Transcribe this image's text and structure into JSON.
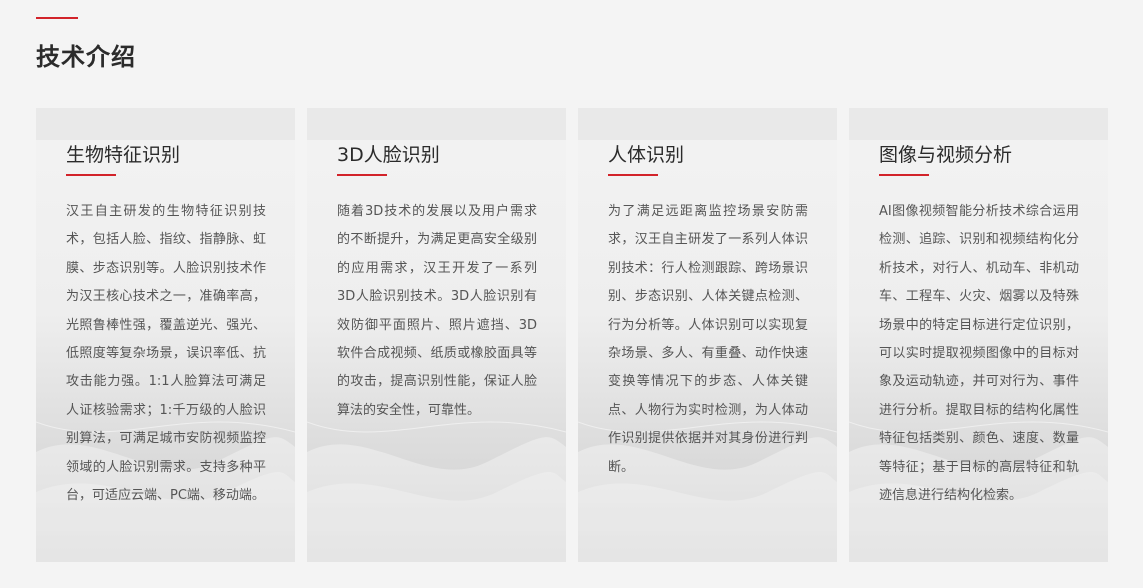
{
  "section": {
    "title": "技术介绍"
  },
  "cards": [
    {
      "title": "生物特征识别",
      "text": "汉王自主研发的生物特征识别技术，包括人脸、指纹、指静脉、虹膜、步态识别等。人脸识别技术作为汉王核心技术之一，准确率高，光照鲁棒性强，覆盖逆光、强光、低照度等复杂场景，误识率低、抗攻击能力强。1:1人脸算法可满足人证核验需求；1:千万级的人脸识别算法，可满足城市安防视频监控领域的人脸识别需求。支持多种平台，可适应云端、PC端、移动端。"
    },
    {
      "title": "3D人脸识别",
      "text": "随着3D技术的发展以及用户需求的不断提升，为满足更高安全级别的应用需求，汉王开发了一系列3D人脸识别技术。3D人脸识别有效防御平面照片、照片遮挡、3D软件合成视频、纸质或橡胶面具等的攻击，提高识别性能，保证人脸算法的安全性，可靠性。"
    },
    {
      "title": "人体识别",
      "text": "为了满足远距离监控场景安防需求，汉王自主研发了一系列人体识别技术：行人检测跟踪、跨场景识别、步态识别、人体关键点检测、行为分析等。人体识别可以实现复杂场景、多人、有重叠、动作快速变换等情况下的步态、人体关键点、人物行为实时检测，为人体动作识别提供依据并对其身份进行判断。"
    },
    {
      "title": "图像与视频分析",
      "text": "AI图像视频智能分析技术综合运用检测、追踪、识别和视频结构化分析技术，对行人、机动车、非机动车、工程车、火灾、烟雾以及特殊场景中的特定目标进行定位识别，可以实时提取视频图像中的目标对象及运动轨迹，并可对行为、事件进行分析。提取目标的结构化属性特征包括类别、颜色、速度、数量等特征；基于目标的高层特征和轨迹信息进行结构化检索。"
    }
  ],
  "colors": {
    "accent": "#d2232a",
    "background": "#f4f4f4"
  }
}
